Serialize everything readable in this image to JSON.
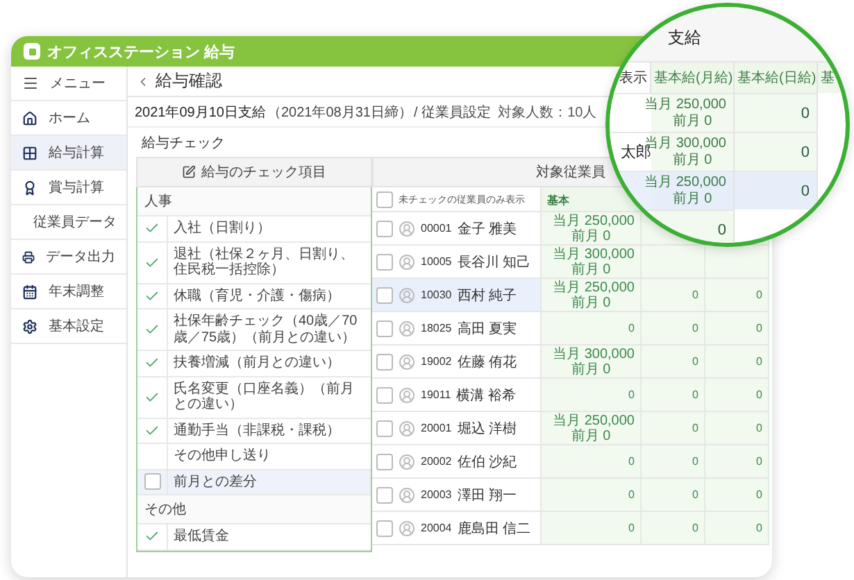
{
  "app": {
    "title": "オフィスステーション 給与"
  },
  "sidebar": {
    "menu_label": "メニュー",
    "items": [
      {
        "label": "ホーム",
        "kind": "home",
        "selected": false
      },
      {
        "label": "給与計算",
        "kind": "calc",
        "selected": true
      },
      {
        "label": "賞与計算",
        "kind": "award",
        "selected": false
      },
      {
        "label": "従業員データ",
        "kind": "people",
        "selected": false
      },
      {
        "label": "データ出力",
        "kind": "print",
        "selected": false
      },
      {
        "label": "年末調整",
        "kind": "year",
        "selected": false
      },
      {
        "label": "基本設定",
        "kind": "settings",
        "selected": false
      }
    ]
  },
  "page": {
    "title": "給与確認",
    "pay_date": "2021年09月10日支給",
    "close_date": "（2021年08月31日締）",
    "settings_link": "/ 従業員設定",
    "headcount": "対象人数：10人"
  },
  "section_label": "給与チェック",
  "check_panel": {
    "header": "給与のチェック項目",
    "groups": [
      {
        "label": "人事",
        "items": [
          {
            "label": "入社（日割り）",
            "kind": "mark",
            "checked": true,
            "selected": false
          },
          {
            "label": "退社（社保２ヶ月、日割り、住民税一括控除）",
            "kind": "mark",
            "checked": true,
            "selected": false
          },
          {
            "label": "休職（育児・介護・傷病）",
            "kind": "mark",
            "checked": true,
            "selected": false
          },
          {
            "label": "社保年齢チェック（40歳／70歳／75歳）（前月との違い）",
            "kind": "mark",
            "checked": true,
            "selected": false
          },
          {
            "label": "扶養増減（前月との違い）",
            "kind": "mark",
            "checked": true,
            "selected": false
          },
          {
            "label": "氏名変更（口座名義）（前月との違い）",
            "kind": "mark",
            "checked": true,
            "selected": false
          },
          {
            "label": "通勤手当（非課税・課税）",
            "kind": "mark",
            "checked": true,
            "selected": false
          },
          {
            "label": "その他申し送り",
            "kind": "mark",
            "checked": false,
            "selected": false
          },
          {
            "label": "前月との差分",
            "kind": "checkbox",
            "checked": false,
            "selected": true
          }
        ]
      },
      {
        "label": "その他",
        "items": [
          {
            "label": "最低賃金",
            "kind": "mark",
            "checked": true,
            "selected": false
          }
        ]
      }
    ]
  },
  "employees": {
    "header": "対象従業員",
    "filter_label": "未チェックの従業員のみ表示",
    "filter_checked": false,
    "data_header": "基本",
    "rows": [
      {
        "code": "00001",
        "name": "金子 雅美",
        "checked": false,
        "selected": false,
        "cells": [
          {
            "kind": "split",
            "current": "当月 250,000",
            "previous": "前月 0"
          }
        ]
      },
      {
        "code": "10005",
        "name": "長谷川 知己",
        "checked": false,
        "selected": false,
        "cells": [
          {
            "kind": "split",
            "current": "当月 300,000",
            "previous": "前月 0"
          }
        ]
      },
      {
        "code": "10030",
        "name": "西村 純子",
        "checked": false,
        "selected": true,
        "cells": [
          {
            "kind": "split",
            "current": "当月 250,000",
            "previous": "前月 0"
          },
          {
            "kind": "value",
            "value": "0"
          },
          {
            "kind": "value",
            "value": "0"
          }
        ]
      },
      {
        "code": "18025",
        "name": "高田 夏実",
        "checked": false,
        "selected": false,
        "cells": [
          {
            "kind": "value",
            "value": "0"
          },
          {
            "kind": "value",
            "value": "0"
          },
          {
            "kind": "value",
            "value": "0"
          }
        ]
      },
      {
        "code": "19002",
        "name": "佐藤 侑花",
        "checked": false,
        "selected": false,
        "cells": [
          {
            "kind": "split",
            "current": "当月 300,000",
            "previous": "前月 0"
          },
          {
            "kind": "value",
            "value": "0"
          },
          {
            "kind": "value",
            "value": "0"
          }
        ]
      },
      {
        "code": "19011",
        "name": "横溝 裕希",
        "checked": false,
        "selected": false,
        "cells": [
          {
            "kind": "value",
            "value": "0"
          },
          {
            "kind": "value",
            "value": "0"
          },
          {
            "kind": "value",
            "value": "0"
          }
        ]
      },
      {
        "code": "20001",
        "name": "堀込 洋樹",
        "checked": false,
        "selected": false,
        "cells": [
          {
            "kind": "split",
            "current": "当月 250,000",
            "previous": "前月 0"
          },
          {
            "kind": "value",
            "value": "0"
          },
          {
            "kind": "value",
            "value": "0"
          }
        ]
      },
      {
        "code": "20002",
        "name": "佐伯 沙紀",
        "checked": false,
        "selected": false,
        "cells": [
          {
            "kind": "value",
            "value": "0"
          },
          {
            "kind": "value",
            "value": "0"
          },
          {
            "kind": "value",
            "value": "0"
          }
        ]
      },
      {
        "code": "20003",
        "name": "澤田 翔一",
        "checked": false,
        "selected": false,
        "cells": [
          {
            "kind": "value",
            "value": "0"
          },
          {
            "kind": "value",
            "value": "0"
          },
          {
            "kind": "value",
            "value": "0"
          }
        ]
      },
      {
        "code": "20004",
        "name": "鹿島田 信二",
        "checked": false,
        "selected": false,
        "cells": [
          {
            "kind": "value",
            "value": "0"
          },
          {
            "kind": "value",
            "value": "0"
          },
          {
            "kind": "value",
            "value": "0"
          }
        ]
      }
    ]
  },
  "magnifier": {
    "header": "支給",
    "columns": [
      "表示",
      "基本給(月給)",
      "基本給(日給)",
      "基"
    ],
    "rows": [
      {
        "selected": false,
        "cells": [
          {
            "kind": "empty"
          },
          {
            "kind": "split",
            "current": "当月 250,000",
            "previous": "前月 0"
          },
          {
            "kind": "value",
            "value": "0"
          }
        ]
      },
      {
        "selected": false,
        "cells": [
          {
            "kind": "name",
            "value": "太郎"
          },
          {
            "kind": "split",
            "current": "当月 300,000",
            "previous": "前月 0"
          },
          {
            "kind": "value",
            "value": "0"
          }
        ]
      },
      {
        "selected": true,
        "cells": [
          {
            "kind": "empty"
          },
          {
            "kind": "split",
            "current": "当月 250,000",
            "previous": "前月 0"
          },
          {
            "kind": "value",
            "value": "0"
          }
        ]
      },
      {
        "selected": false,
        "cells": [
          {
            "kind": "empty"
          },
          {
            "kind": "value",
            "value": "0"
          }
        ]
      }
    ]
  }
}
